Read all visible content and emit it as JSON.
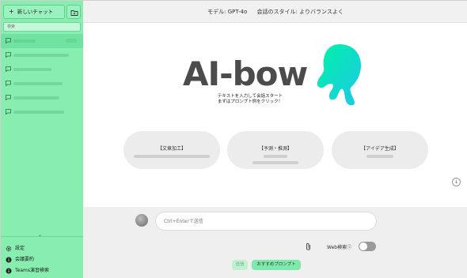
{
  "sidebar": {
    "new_chat_label": "新しいチャット",
    "search_placeholder": "検索",
    "chat_items": [
      {
        "active": true
      },
      {
        "active": false
      },
      {
        "active": false
      },
      {
        "active": false
      },
      {
        "active": false
      },
      {
        "active": false
      }
    ],
    "footer": {
      "settings": "設定",
      "terms": "会議要約",
      "teams": "Teams演習検索"
    }
  },
  "header": {
    "model_label": "モデル: GPT-4o",
    "style_label": "会話のスタイル: よりバランスよく"
  },
  "main": {
    "logo_text": "AI-bow",
    "tagline_line1": "テキストを入力して会話スタート",
    "tagline_line2": "まずはプロンプト例をクリック！",
    "cards": [
      {
        "title": "【文章加工】"
      },
      {
        "title": "【予測・推測】"
      },
      {
        "title": "【アイデア生成】"
      }
    ]
  },
  "input": {
    "placeholder": "Ctrl+Enterで送信",
    "web_search_label": "Web検索",
    "web_search_enabled": false,
    "send_label": "送信",
    "prompt_button_label": "おすすめプロンプト"
  },
  "colors": {
    "sidebar_bg": "#87eeb0",
    "accent": "#7fe8ab",
    "mascot_gradient": [
      "#00f0b0",
      "#2bd0e0"
    ]
  }
}
